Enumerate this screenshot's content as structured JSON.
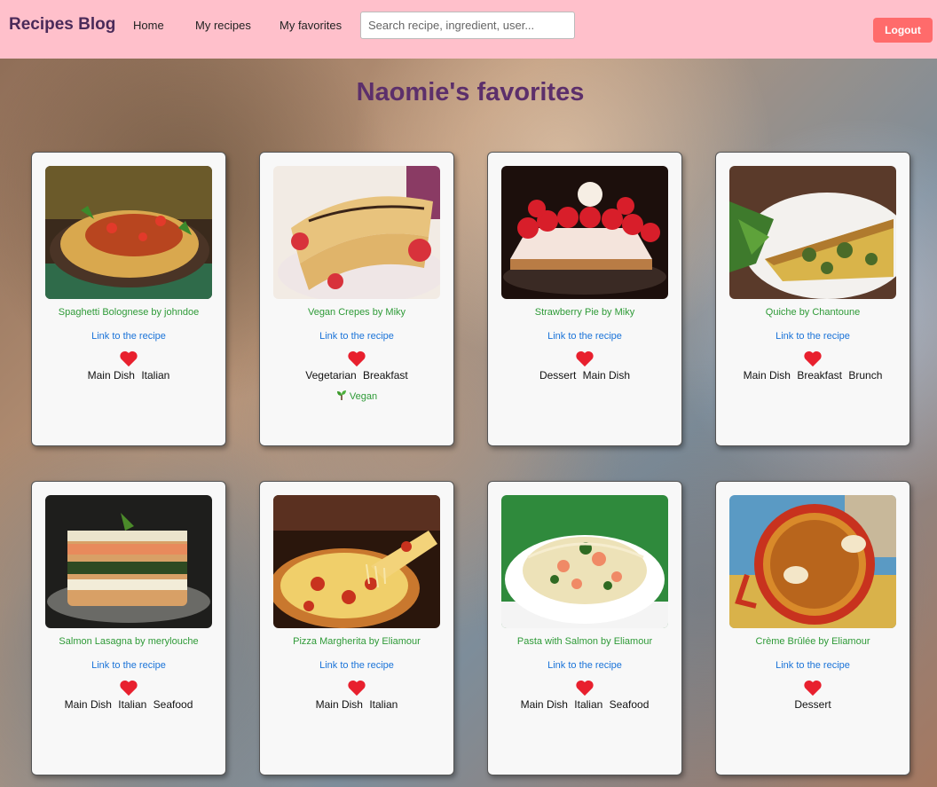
{
  "header": {
    "brand": "Recipes Blog",
    "nav": [
      "Home",
      "My recipes",
      "My favorites"
    ],
    "search_placeholder": "Search recipe, ingredient, user...",
    "logout": "Logout"
  },
  "page_title": "Naomie's favorites",
  "recipes": [
    {
      "title": "Spaghetti Bolognese by johndoe",
      "link": "Link to the recipe",
      "tags": [
        "Main Dish",
        "Italian"
      ]
    },
    {
      "title": "Vegan Crepes by Miky",
      "link": "Link to the recipe",
      "tags": [
        "Vegetarian",
        "Breakfast"
      ],
      "badge": "Vegan"
    },
    {
      "title": "Strawberry Pie by Miky",
      "link": "Link to the recipe",
      "tags": [
        "Dessert",
        "Main Dish"
      ]
    },
    {
      "title": "Quiche by Chantoune",
      "link": "Link to the recipe",
      "tags": [
        "Main Dish",
        "Breakfast",
        "Brunch"
      ]
    },
    {
      "title": "Salmon Lasagna by merylouche",
      "link": "Link to the recipe",
      "tags": [
        "Main Dish",
        "Italian",
        "Seafood"
      ]
    },
    {
      "title": "Pizza Margherita by Eliamour",
      "link": "Link to the recipe",
      "tags": [
        "Main Dish",
        "Italian"
      ]
    },
    {
      "title": "Pasta with Salmon by Eliamour",
      "link": "Link to the recipe",
      "tags": [
        "Main Dish",
        "Italian",
        "Seafood"
      ]
    },
    {
      "title": "Crème Brûlée by Eliamour",
      "link": "Link to the recipe",
      "tags": [
        "Dessert"
      ]
    }
  ],
  "icons": {
    "favorite": "heart-icon",
    "vegan": "seedling-icon"
  },
  "colors": {
    "navbar": "#ffc0cb",
    "logout": "#ff6b6b",
    "title": "#5c2f6b",
    "card_title": "#2e9a37",
    "link": "#1a73d8",
    "heart": "#e8202e"
  }
}
